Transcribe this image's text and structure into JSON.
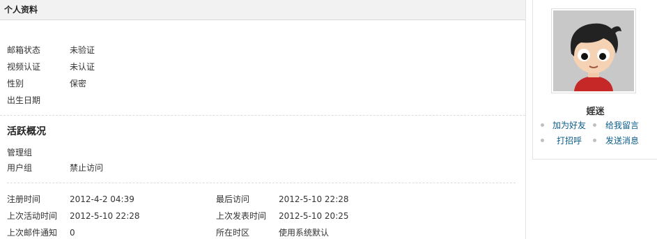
{
  "header": {
    "title": "个人资料"
  },
  "profile": {
    "email_status": {
      "label": "邮箱状态",
      "value": "未验证"
    },
    "video_auth": {
      "label": "视频认证",
      "value": "未认证"
    },
    "gender": {
      "label": "性别",
      "value": "保密"
    },
    "birthday": {
      "label": "出生日期",
      "value": ""
    }
  },
  "activity": {
    "title": "活跃概况",
    "admin_group": {
      "label": "管理组",
      "value": ""
    },
    "user_group": {
      "label": "用户组",
      "value": "禁止访问"
    }
  },
  "stats": {
    "register_time": {
      "label": "注册时间",
      "value": "2012-4-2 04:39"
    },
    "last_visit": {
      "label": "最后访问",
      "value": "2012-5-10 22:28"
    },
    "last_active": {
      "label": "上次活动时间",
      "value": "2012-5-10 22:28"
    },
    "last_post": {
      "label": "上次发表时间",
      "value": "2012-5-10 20:25"
    },
    "last_mail": {
      "label": "上次邮件通知",
      "value": "0"
    },
    "timezone": {
      "label": "所在时区",
      "value": "使用系统默认"
    }
  },
  "sidebar": {
    "username": "婬迷",
    "actions": {
      "add_friend": "加为好友",
      "leave_message": "给我留言",
      "poke": "打招呼",
      "send_message": "发送消息"
    }
  }
}
